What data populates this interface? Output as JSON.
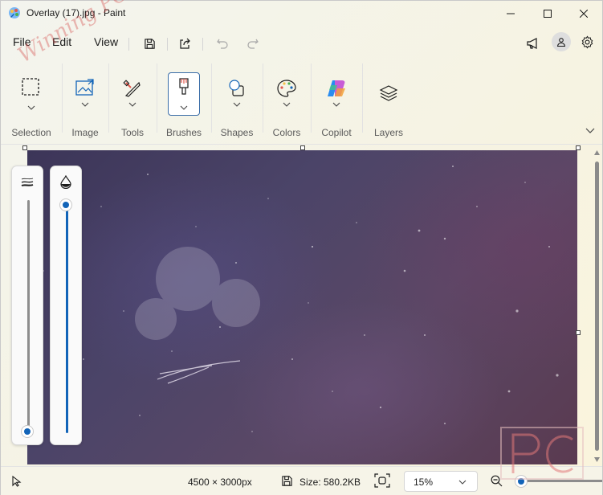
{
  "window": {
    "title": "Overlay (17).jpg - Paint",
    "controls": [
      "minimize-icon",
      "maximize-icon",
      "close-icon"
    ]
  },
  "menu": {
    "items": [
      "File",
      "Edit",
      "View"
    ],
    "quick_actions": [
      "save-icon",
      "share-icon",
      "undo-icon",
      "redo-icon"
    ],
    "right": [
      "megaphone-icon",
      "account-icon",
      "gear-icon"
    ]
  },
  "ribbon": {
    "groups": [
      {
        "label": "Selection",
        "icon": "selection-icon"
      },
      {
        "label": "Image",
        "icon": "image-icon"
      },
      {
        "label": "Tools",
        "icon": "tools-icon"
      },
      {
        "label": "Brushes",
        "icon": "brush-icon"
      },
      {
        "label": "Shapes",
        "icon": "shapes-icon"
      },
      {
        "label": "Colors",
        "icon": "palette-icon"
      },
      {
        "label": "Copilot",
        "icon": "copilot-icon"
      },
      {
        "label": "Layers",
        "icon": "layers-icon"
      }
    ]
  },
  "canvas": {
    "image_name": "Overlay (17).jpg",
    "colors": {
      "dark": "#3c3558",
      "mid": "#4b4468",
      "plum": "#5a3a50"
    }
  },
  "sliders": {
    "size_icon": "stroke-size-icon",
    "size_level": 0.0,
    "opacity_icon": "opacity-drop-icon",
    "opacity_level": 1.0
  },
  "status": {
    "pointer_icon": "pointer-icon",
    "dimensions": "4500 × 3000px",
    "size": "Size: 580.2KB",
    "zoom": "15%",
    "zoom_level": 0.0
  },
  "watermark": {
    "text": "Winning PC",
    "logo": "PC"
  },
  "colors": {
    "accent": "#1264b8",
    "background": "#f6f4e8"
  }
}
